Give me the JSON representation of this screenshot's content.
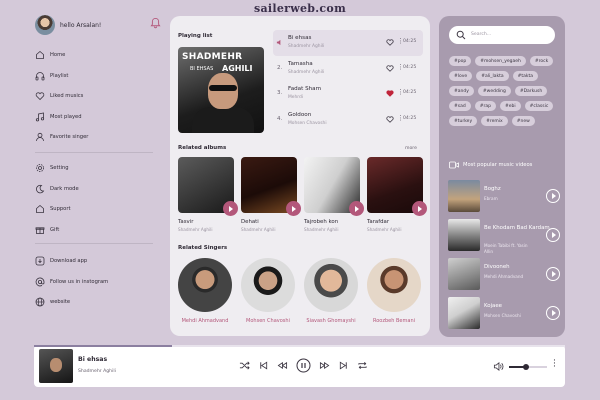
{
  "watermark": "sailerweb.com",
  "user": {
    "greeting": "hello Arsalan!"
  },
  "nav_primary": [
    {
      "label": "Home",
      "icon": "home-icon"
    },
    {
      "label": "Playlist",
      "icon": "headphones-icon"
    },
    {
      "label": "Liked musics",
      "icon": "heart-icon"
    },
    {
      "label": "Most played",
      "icon": "music-note-icon"
    },
    {
      "label": "Favorite singer",
      "icon": "user-icon"
    }
  ],
  "nav_secondary": [
    {
      "label": "Setting",
      "icon": "gear-icon"
    },
    {
      "label": "Dark mode",
      "icon": "moon-icon"
    },
    {
      "label": "Support",
      "icon": "home-icon"
    },
    {
      "label": "Gift",
      "icon": "gift-icon"
    }
  ],
  "nav_tertiary": [
    {
      "label": "Download app",
      "icon": "download-icon"
    },
    {
      "label": "Follow us in instogram",
      "icon": "at-icon"
    },
    {
      "label": "website",
      "icon": "globe-icon"
    }
  ],
  "playing": {
    "heading": "Playing list",
    "cover": {
      "line1": "SHADMEHR",
      "line2": "BI EHSAS",
      "line3": "AGHILI"
    },
    "tracks": [
      {
        "num": "",
        "title": "Bi ehsas",
        "artist": "Shadmehr Aghili",
        "duration": "04:25",
        "liked": false,
        "active": true
      },
      {
        "num": "2.",
        "title": "Tamasha",
        "artist": "Shadmehr Aghili",
        "duration": "04:25",
        "liked": false,
        "active": false
      },
      {
        "num": "3.",
        "title": "Fadat Sham",
        "artist": "Mehrdi",
        "duration": "04:25",
        "liked": true,
        "active": false
      },
      {
        "num": "4.",
        "title": "Goldoon",
        "artist": "Mohsen Chavoshi",
        "duration": "04:25",
        "liked": false,
        "active": false
      }
    ]
  },
  "albums": {
    "heading": "Related albums",
    "more": "more",
    "items": [
      {
        "name": "Tasvir",
        "artist": "Shadmehr Aghili"
      },
      {
        "name": "Dehati",
        "artist": "Shadmehr Aghili"
      },
      {
        "name": "Tajrobeh kon",
        "artist": "Shadmehr Aghili"
      },
      {
        "name": "Tarafdar",
        "artist": "Shadmehr Aghili"
      }
    ]
  },
  "singers": {
    "heading": "Related Singers",
    "items": [
      {
        "name": "Mehdi Ahmadvand"
      },
      {
        "name": "Mohsen Chavoshi"
      },
      {
        "name": "Siavash Ghomayshi"
      },
      {
        "name": "Roozbeh Bemani"
      }
    ]
  },
  "search": {
    "placeholder": "Search..."
  },
  "tags": [
    "#pop",
    "#mohsen_yegaeh",
    "#rock",
    "#love",
    "#ali_lakta",
    "#takta",
    "#andy",
    "#wedding",
    "#Darkush",
    "#sad",
    "#rap",
    "#ebi",
    "#classic",
    "#turkey",
    "#remix",
    "#new"
  ],
  "videos": {
    "heading": "Most popular music videos",
    "items": [
      {
        "title": "Boghz",
        "artist": "Ebram"
      },
      {
        "title": "Be Khodam Bad Kardam",
        "artist": "Moein Tabibi ft. Yasin Allin"
      },
      {
        "title": "Divooneh",
        "artist": "Mehdi Ahmadvand"
      },
      {
        "title": "Kojaee",
        "artist": "Mohsen Chavoshi"
      }
    ]
  },
  "player": {
    "title": "Bi ehsas",
    "artist": "Shadmehr Aghili",
    "progress": 0.26,
    "volume": 0.45
  },
  "colors": {
    "accent": "#b3577a",
    "background": "#d4c9d9",
    "panel": "#efedf1",
    "right_panel": "#a89bae"
  }
}
